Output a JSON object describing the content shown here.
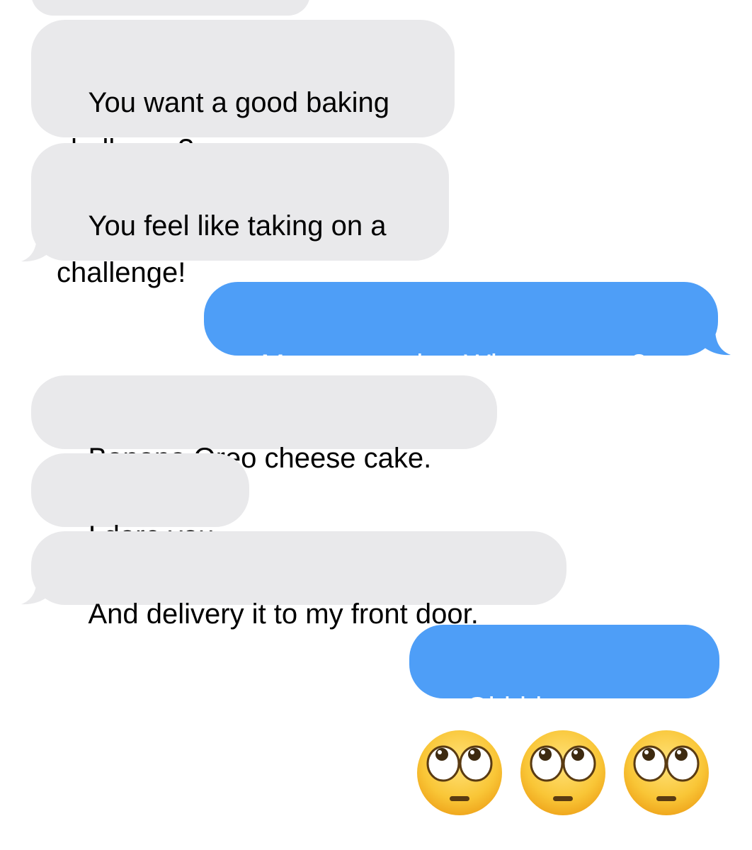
{
  "conversation": {
    "messages": [
      {
        "id": "m0",
        "direction": "incoming",
        "text": ""
      },
      {
        "id": "m1",
        "direction": "incoming",
        "text": "You want a good baking\nchallenge?"
      },
      {
        "id": "m2",
        "direction": "incoming",
        "text": "You feel like taking on a\nchallenge!"
      },
      {
        "id": "m3",
        "direction": "outgoing",
        "text": "Mmmm maybe. What you got?"
      },
      {
        "id": "m4",
        "direction": "incoming",
        "text": "Banana Oreo cheese cake."
      },
      {
        "id": "m5",
        "direction": "incoming",
        "text": "I dare you."
      },
      {
        "id": "m6",
        "direction": "incoming",
        "text": "And delivery it to my front door."
      },
      {
        "id": "m7",
        "direction": "outgoing",
        "text": "Ohhhh geeeeeez"
      }
    ],
    "emoji_message": {
      "direction": "outgoing",
      "emojis": [
        "face-with-rolling-eyes",
        "face-with-rolling-eyes",
        "face-with-rolling-eyes"
      ]
    }
  },
  "colors": {
    "incoming_bubble": "#e9e9eb",
    "outgoing_bubble": "#4e9ef7",
    "incoming_text": "#000000",
    "outgoing_text": "#ffffff",
    "emoji_face": "#f7c431"
  }
}
